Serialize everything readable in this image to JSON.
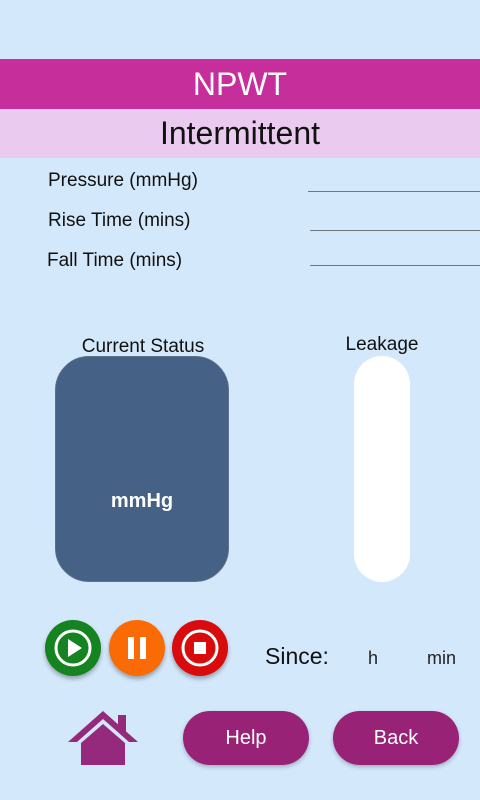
{
  "header": {
    "title": "NPWT",
    "mode": "Intermittent"
  },
  "params": [
    {
      "label": "Pressure (mmHg)",
      "value": ""
    },
    {
      "label": "Rise Time (mins)",
      "value": ""
    },
    {
      "label": "Fall Time (mins)",
      "value": ""
    }
  ],
  "status": {
    "label": "Current Status",
    "unit": "mmHg"
  },
  "leakage": {
    "label": "Leakage"
  },
  "controls": {
    "play": "play-icon",
    "pause": "pause-icon",
    "stop": "stop-icon"
  },
  "since": {
    "label": "Since:",
    "hours_unit": "h",
    "minutes_unit": "min"
  },
  "nav": {
    "home_icon": "home-icon",
    "help_label": "Help",
    "back_label": "Back"
  },
  "colors": {
    "background": "#d4e8fc",
    "title_bar": "#c62e9b",
    "subtitle_bar": "#ebcaf0",
    "status_box": "#456185",
    "play": "#15831f",
    "pause": "#fb6b05",
    "stop": "#d80c0c",
    "pill": "#982376",
    "home": "#952a7c"
  }
}
